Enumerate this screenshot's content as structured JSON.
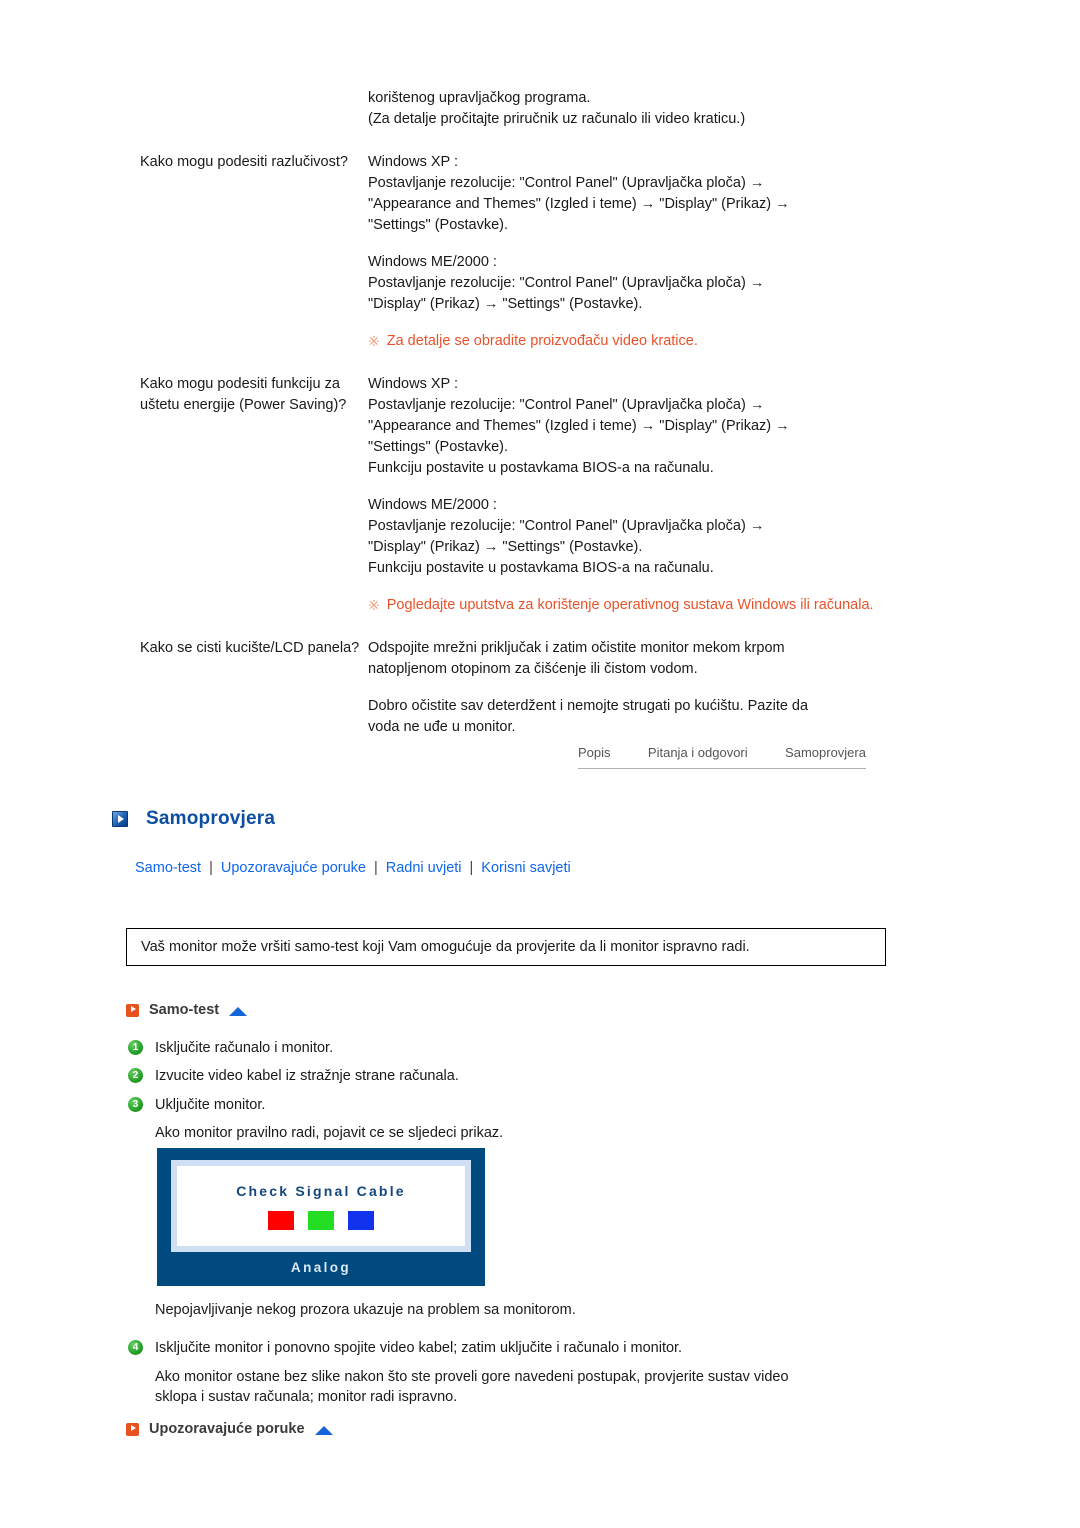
{
  "faq": {
    "intro_lines": [
      "korištenog upravljačkog programa.",
      "(Za detalje pročitajte priručnik uz računalo ili video kraticu.)"
    ],
    "rows": [
      {
        "question": "Kako mogu podesiti razlučivost?",
        "blocks": [
          [
            "Windows XP :",
            "Postavljanje rezolucije: \"Control Panel\" (Upravljačka ploča) →",
            "\"Appearance and Themes\" (Izgled i teme) → \"Display\" (Prikaz) →",
            "\"Settings\" (Postavke)."
          ],
          [
            "Windows ME/2000 :",
            "Postavljanje rezolucije: \"Control Panel\" (Upravljačka ploča) →",
            "\"Display\" (Prikaz) → \"Settings\" (Postavke)."
          ]
        ],
        "note_mark": "※",
        "note": "Za detalje se obradite proizvođaču video kratice."
      },
      {
        "question": "Kako mogu podesiti funkciju za uštetu energije (Power Saving)?",
        "blocks": [
          [
            "Windows XP :",
            "Postavljanje rezolucije: \"Control Panel\" (Upravljačka ploča) →",
            "\"Appearance and Themes\" (Izgled i teme) → \"Display\" (Prikaz) →",
            "\"Settings\" (Postavke).",
            "Funkciju postavite u postavkama BIOS-a na računalu."
          ],
          [
            "Windows ME/2000 :",
            "Postavljanje rezolucije: \"Control Panel\" (Upravljačka ploča) →",
            "\"Display\" (Prikaz) → \"Settings\" (Postavke).",
            "Funkciju postavite u postavkama BIOS-a na računalu."
          ]
        ],
        "note_mark": "※",
        "note": "Pogledajte uputstva za korištenje operativnog sustava Windows ili računala."
      },
      {
        "question": "Kako se cisti kucište/LCD panela?",
        "blocks": [
          [
            "Odspojite mrežni priključak i zatim očistite monitor mekom krpom",
            "natopljenom otopinom za čišćenje ili čistom vodom."
          ],
          [
            "Dobro očistite sav deterdžent i nemojte strugati po kućištu. Pazite da",
            "voda ne uđe u monitor."
          ]
        ],
        "note_mark": "",
        "note": ""
      }
    ]
  },
  "pager": {
    "items": [
      {
        "label": "Popis"
      },
      {
        "label": "Pitanja i odgovori"
      },
      {
        "label": "Samoprovjera"
      }
    ]
  },
  "section": {
    "icon": "play-icon",
    "title": "Samoprovjera",
    "title_color": "#0b4ea2"
  },
  "sublinks": {
    "separator": "|",
    "items": [
      {
        "label": "Samo-test"
      },
      {
        "label": "Upozoravajuće poruke"
      },
      {
        "label": "Radni uvjeti"
      },
      {
        "label": "Korisni savjeti"
      }
    ],
    "color": "#1166ee"
  },
  "intro_box": {
    "text": "Vaš monitor može vršiti samo-test koji Vam omogućuje da provjerite da li monitor ispravno radi."
  },
  "selftest": {
    "heading": "Samo-test",
    "heading_icon": "play-icon",
    "top_icon": "up-arrow-icon",
    "steps": [
      {
        "num": "1",
        "text": "Isključite računalo i monitor."
      },
      {
        "num": "2",
        "text": "Izvucite video kabel iz stražnje strane računala."
      },
      {
        "num": "3",
        "text": "Uključite monitor."
      }
    ],
    "after_step3": "Ako monitor pravilno radi, pojavit ce se sljedeci prikaz.",
    "monitor": {
      "message": "Check Signal Cable",
      "label": "Analog",
      "frame_color": "#004a80",
      "message_color": "#14477e",
      "swatches": [
        {
          "name": "red",
          "color": "#ff0000"
        },
        {
          "name": "green",
          "color": "#22dd22"
        },
        {
          "name": "blue",
          "color": "#1133ee"
        }
      ]
    },
    "after_monitor": "Nepojavljivanje nekog prozora ukazuje na problem sa monitorom.",
    "step4": {
      "num": "4",
      "text": "Isključite monitor i ponovno spojite video kabel; zatim uključite i računalo i monitor."
    },
    "final_lines": [
      "Ako monitor ostane bez slike nakon što ste proveli gore navedeni postupak, provjerite sustav video",
      "sklopa i sustav računala; monitor radi ispravno."
    ]
  },
  "warnings": {
    "heading": "Upozoravajuće poruke",
    "heading_icon": "play-icon",
    "top_icon": "up-arrow-icon"
  }
}
